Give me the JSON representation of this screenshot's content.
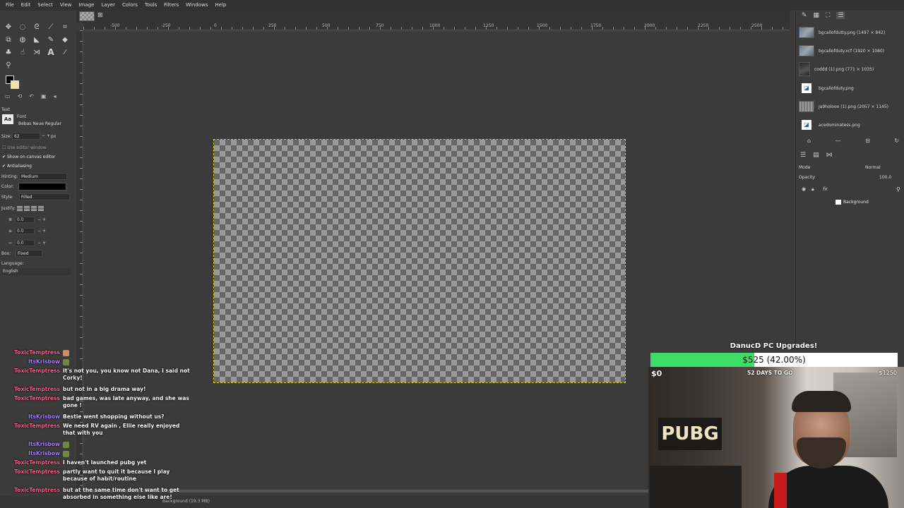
{
  "menu": [
    "File",
    "Edit",
    "Select",
    "View",
    "Image",
    "Layer",
    "Colors",
    "Tools",
    "Filters",
    "Windows",
    "Help"
  ],
  "ruler": {
    "h_labels": [
      "-500",
      "-250",
      "0",
      "250",
      "500",
      "750",
      "1000",
      "1250",
      "1500",
      "1750",
      "2000",
      "2250",
      "2500"
    ]
  },
  "tool_options": {
    "section_title": "Text",
    "font_label": "Font",
    "font_value": "Bebas Neue Regular",
    "font_icon_text": "Aa",
    "size_label": "Size:",
    "size_value": "62",
    "size_unit": "px",
    "use_editor": "Use editor window",
    "show_canvas_editor": "Show on-canvas editor",
    "antialiasing": "Antialiasing",
    "hinting_label": "Hinting:",
    "hinting_value": "Medium",
    "color_label": "Color:",
    "style_label": "Style:",
    "style_value": "Filled",
    "justify_label": "Justify:",
    "indent_value": "0.0",
    "line_spacing_value": "0.0",
    "letter_spacing_value": "0.0",
    "box_label": "Box:",
    "box_value": "Fixed",
    "language_label": "Language:",
    "language_value": "English"
  },
  "documents": [
    {
      "name": "bgcallofdutty.png (1497 × 842)",
      "thumb": "photo"
    },
    {
      "name": "bgcallofduty.xcf (1920 × 1080)",
      "thumb": "photo"
    },
    {
      "name": "coddd (1).png (771 × 1035)",
      "thumb": "dark"
    },
    {
      "name": "bgcallofduty.png",
      "thumb": "file"
    },
    {
      "name": "ja9holooo (1).png (2057 × 1145)",
      "thumb": "grey"
    },
    {
      "name": "acedominatess.png",
      "thumb": "file"
    }
  ],
  "layers": {
    "mode_label": "Mode",
    "mode_value": "Normal",
    "opacity_label": "Opacity",
    "opacity_value": "100.0",
    "layer_name": "Background"
  },
  "status": {
    "text": "Background (19.3 MB)"
  },
  "chat": [
    {
      "user": "ToxicTemptress",
      "type": "toxic",
      "msg": ""
    },
    {
      "user": "ItsKrisbow",
      "type": "krisbow",
      "msg": ""
    },
    {
      "user": "ToxicTemptress",
      "type": "toxic",
      "msg": "It's not you, you know not Dana, I said not Corky!"
    },
    {
      "user": "ToxicTemptress",
      "type": "toxic",
      "msg": "but not in a big drama way!"
    },
    {
      "user": "ToxicTemptress",
      "type": "toxic",
      "msg": "bad games, was late anyway, and she was gone !"
    },
    {
      "user": "ItsKrisbow",
      "type": "krisbow",
      "msg": "Bestie went shopping without us?"
    },
    {
      "user": "ToxicTemptress",
      "type": "toxic",
      "msg": "We need RV again , Ellie really enjoyed that with you"
    },
    {
      "user": "ItsKrisbow",
      "type": "krisbow",
      "msg": ""
    },
    {
      "user": "ItsKrisbow",
      "type": "krisbow",
      "msg": ""
    },
    {
      "user": "ToxicTemptress",
      "type": "toxic",
      "msg": "I haven't launched pubg yet"
    },
    {
      "user": "ToxicTemptress",
      "type": "toxic",
      "msg": "partly want to quit it because I play because of habit/routine"
    },
    {
      "user": "ToxicTemptress",
      "type": "toxic",
      "msg": "but at the same time don't want to get absorbed in something else like are!"
    }
  ],
  "donation": {
    "title": "DanucD PC Upgrades!",
    "progress_text": "$525 (42.00%)",
    "progress_fraction": 0.42,
    "min": "$0",
    "max": "$1250",
    "days_left": "52 DAYS TO GO",
    "sign_text": "PUBG",
    "bar_color": "#3ddc64"
  }
}
